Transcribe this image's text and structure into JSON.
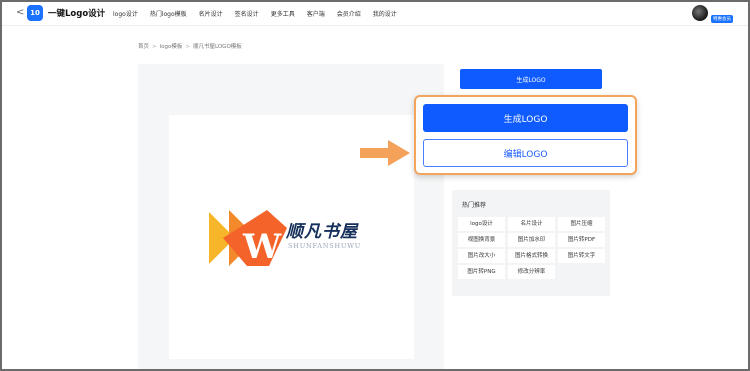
{
  "header": {
    "back_glyph": "<",
    "logo_icon_text": "10",
    "brand": "一键Logo设计",
    "nav": [
      "logo设计",
      "热门logo模板",
      "名片设计",
      "签名设计",
      "更多工具",
      "客户端",
      "会员介绍",
      "我的设计"
    ],
    "vip_badge": "特惠会员",
    "icons": {
      "logo": "app-logo-icon",
      "back": "chevron-left-icon",
      "avatar": "avatar-photo"
    }
  },
  "breadcrumb": [
    "首页",
    "logo模板",
    "顺凡书屋LOGO模板"
  ],
  "preview": {
    "logo_cn": "顺凡书屋",
    "logo_en": "SHUNFANSHUWU",
    "mark_letter": "W"
  },
  "panel": {
    "top_button": "生成LOGO",
    "generate_button": "生成LOGO",
    "edit_button": "编辑LOGO"
  },
  "hot": {
    "title": "热门推荐",
    "tags": [
      "logo设计",
      "名片设计",
      "图片压缩",
      "视图换背景",
      "图片加水印",
      "图片转PDF",
      "图片改大小",
      "图片格式转换",
      "图片转文字",
      "图片转PNG",
      "修改分辨率"
    ]
  },
  "colors": {
    "primary": "#0f5bff",
    "callout_border": "#f3a55e",
    "arrow": "#f4a15a",
    "logo_navy": "#16305c"
  }
}
